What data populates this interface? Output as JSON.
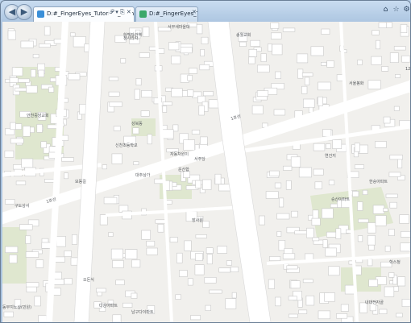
{
  "tabs": [
    {
      "label": "D:#_FingerEyes_Tutorials_#bin-debug#Adi",
      "controls": "𝒫 ▾ ⎘ ✕"
    },
    {
      "label": "D:#_FingerEyes_Tutorials_...",
      "close": "✕"
    }
  ],
  "icons": {
    "back": "back-arrow-icon",
    "forward": "forward-arrow-icon",
    "home": "home-icon",
    "favorites": "star-icon",
    "tools": "gear-icon"
  },
  "window_controls": {
    "home": "⌂",
    "favorites": "☆",
    "tools": "⚙"
  },
  "colors": {
    "land": "#f1f0ed",
    "building": "#ffffff",
    "building_edge": "#c9c9c9",
    "road": "#ffffff",
    "park": "#dfe7cf"
  },
  "map": {
    "labels": [
      "하백자관역",
      "서부새마을대",
      "청사라사",
      "송월교회",
      "안천중앙교회",
      "성북동",
      "신천초등학교",
      "모동길",
      "대추상가",
      "자동차원이",
      "서주당",
      "운산합",
      "서울봉화",
      "12길로",
      "장사원",
      "승산이파트",
      "연건지",
      "한승아파트",
      "오돈식",
      "다상아파트",
      "동부지노상(민원)",
      "남구다이마트",
      "내대전자골",
      "학스청",
      "구도상서"
    ],
    "roads": [
      "1호선",
      "1호선"
    ]
  }
}
